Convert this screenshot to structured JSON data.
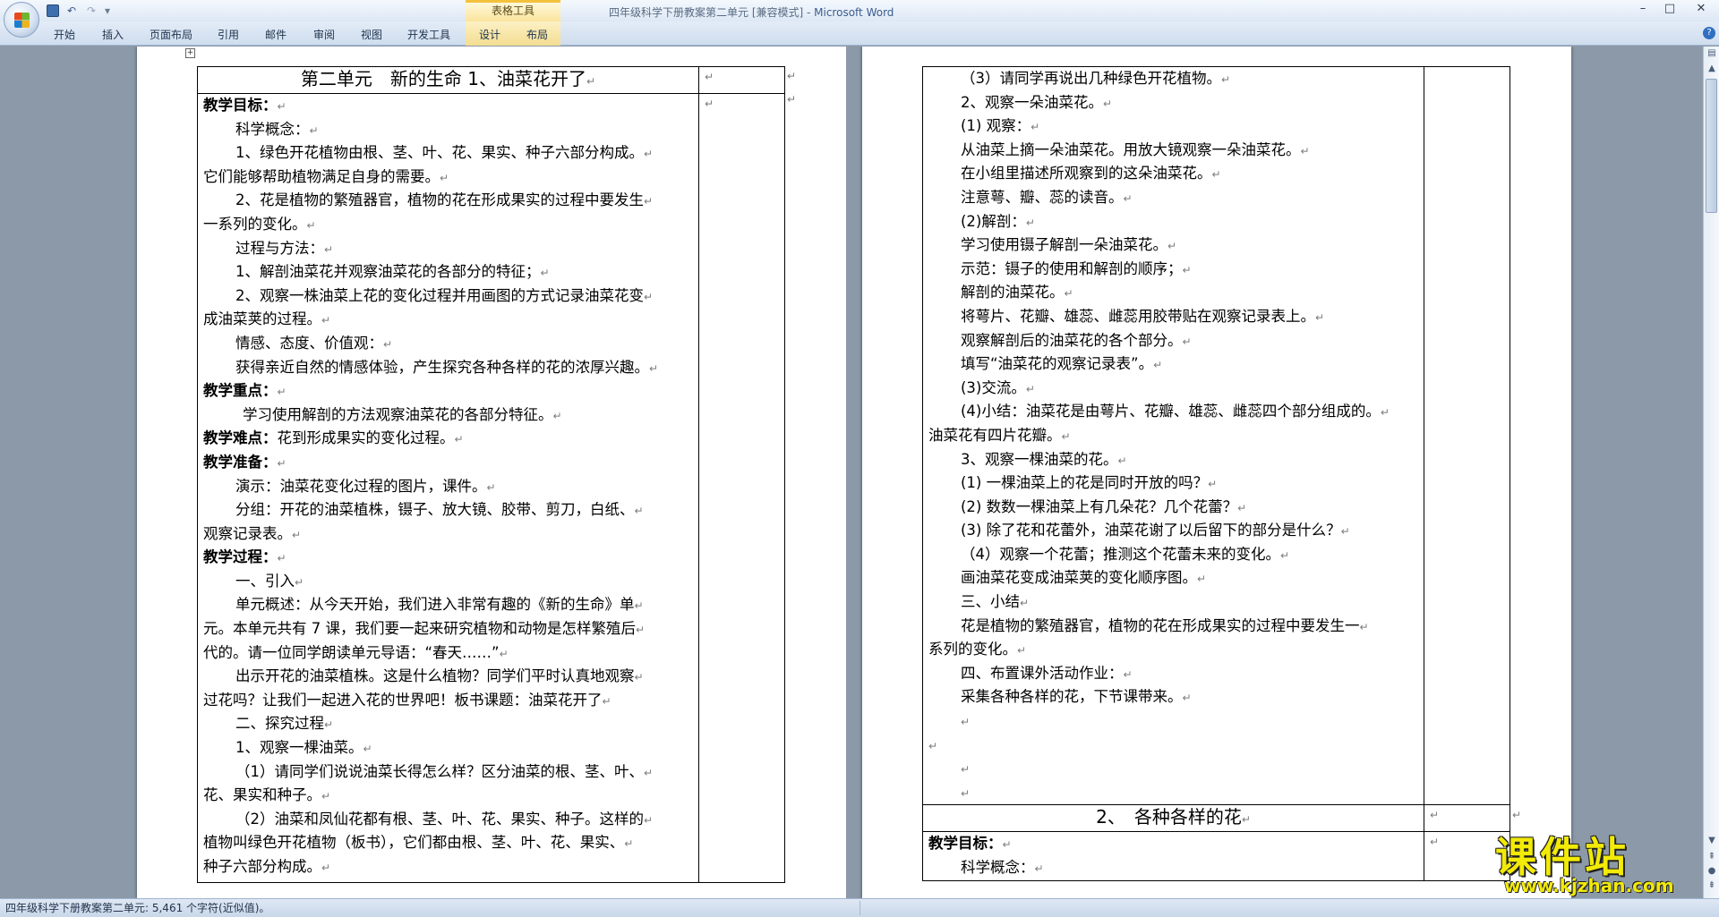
{
  "window": {
    "title": "四年级科学下册教案第二单元 [兼容模式] - ",
    "app_name": "Microsoft Word",
    "context_tab_group": "表格工具",
    "controls": [
      "–",
      "□",
      "✕"
    ]
  },
  "quick_access": {
    "save_icon": "save-icon",
    "undo_icon": "undo-icon",
    "redo_icon": "redo-icon",
    "customize_icon": "customize-qat-icon"
  },
  "ribbon": {
    "tabs": [
      "开始",
      "插入",
      "页面布局",
      "引用",
      "邮件",
      "审阅",
      "视图",
      "开发工具",
      "设计",
      "布局"
    ]
  },
  "status_bar": {
    "text": "四年级科学下册教案第二单元: 5,461 个字符(近似值)。"
  },
  "document": {
    "left_page": {
      "title": "第二单元　新的生命 1、油菜花开了",
      "lines": [
        {
          "text": "教学目标：",
          "style": "b"
        },
        {
          "text": "科学概念：",
          "style": "i2"
        },
        {
          "text": "1、绿色开花植物由根、茎、叶、花、果实、种子六部分构成。",
          "style": "i2"
        },
        {
          "text": "它们能够帮助植物满足自身的需要。",
          "style": ""
        },
        {
          "text": "2、花是植物的繁殖器官，植物的花在形成果实的过程中要发生",
          "style": "i2"
        },
        {
          "text": "一系列的变化。",
          "style": ""
        },
        {
          "text": "过程与方法：",
          "style": "i2"
        },
        {
          "text": "1、解剖油菜花并观察油菜花的各部分的特征；",
          "style": "i2"
        },
        {
          "text": "2、观察一株油菜上花的变化过程并用画图的方式记录油菜花变",
          "style": "i2"
        },
        {
          "text": "成油菜荚的过程。",
          "style": ""
        },
        {
          "text": "情感、态度、价值观：",
          "style": "i2"
        },
        {
          "text": "获得亲近自然的情感体验，产生探究各种各样的花的浓厚兴趣。",
          "style": "i2"
        },
        {
          "text": "教学重点：",
          "style": "b"
        },
        {
          "text": "学习使用解剖的方法观察油菜花的各部分特征。",
          "style": "i3"
        },
        {
          "text": "教学难点：花到形成果实的变化过程。",
          "style": "bl"
        },
        {
          "text": "教学准备：",
          "style": "b"
        },
        {
          "text": "演示：油菜花变化过程的图片，课件。",
          "style": "i2"
        },
        {
          "text": "分组：开花的油菜植株，镊子、放大镜、胶带、剪刀，白纸、",
          "style": "i2"
        },
        {
          "text": "观察记录表。",
          "style": ""
        },
        {
          "text": "教学过程：",
          "style": "b"
        },
        {
          "text": "一、引入",
          "style": "i2"
        },
        {
          "text": "单元概述：从今天开始，我们进入非常有趣的《新的生命》单",
          "style": "i2"
        },
        {
          "text": "元。本单元共有 7 课，我们要一起来研究植物和动物是怎样繁殖后",
          "style": ""
        },
        {
          "text": "代的。请一位同学朗读单元导语：“春天……”",
          "style": ""
        },
        {
          "text": "出示开花的油菜植株。这是什么植物？同学们平时认真地观察",
          "style": "i2"
        },
        {
          "text": "过花吗？让我们一起进入花的世界吧！板书课题：油菜花开了",
          "style": ""
        },
        {
          "text": "二、探究过程",
          "style": "i2"
        },
        {
          "text": "1、观察一棵油菜。",
          "style": "i2"
        },
        {
          "text": "（1）请同学们说说油菜长得怎么样？区分油菜的根、茎、叶、",
          "style": "i2"
        },
        {
          "text": "花、果实和种子。",
          "style": ""
        },
        {
          "text": "（2）油菜和凤仙花都有根、茎、叶、花、果实、种子。这样的",
          "style": "i2"
        },
        {
          "text": "植物叫绿色开花植物（板书），它们都由根、茎、叶、花、果实、",
          "style": ""
        },
        {
          "text": "种子六部分构成。",
          "style": ""
        }
      ]
    },
    "right_page": {
      "lines": [
        {
          "text": "（3）请同学再说出几种绿色开花植物。",
          "style": "i2"
        },
        {
          "text": "2、观察一朵油菜花。",
          "style": "i2"
        },
        {
          "text": "(1) 观察：",
          "style": "i2"
        },
        {
          "text": "从油菜上摘一朵油菜花。用放大镜观察一朵油菜花。",
          "style": "i2"
        },
        {
          "text": "在小组里描述所观察到的这朵油菜花。",
          "style": "i2"
        },
        {
          "text": "注意萼、瓣、蕊的读音。",
          "style": "i2"
        },
        {
          "text": "(2)解剖：",
          "style": "i2"
        },
        {
          "text": "学习使用镊子解剖一朵油菜花。",
          "style": "i2"
        },
        {
          "text": "示范：镊子的使用和解剖的顺序；",
          "style": "i2"
        },
        {
          "text": "解剖的油菜花。",
          "style": "i2"
        },
        {
          "text": "将萼片、花瓣、雄蕊、雌蕊用胶带贴在观察记录表上。",
          "style": "i2"
        },
        {
          "text": "观察解剖后的油菜花的各个部分。",
          "style": "i2"
        },
        {
          "text": "填写“油菜花的观察记录表”。",
          "style": "i2"
        },
        {
          "text": "(3)交流。",
          "style": "i2"
        },
        {
          "text": "(4)小结：油菜花是由萼片、花瓣、雄蕊、雌蕊四个部分组成的。",
          "style": "i2"
        },
        {
          "text": "油菜花有四片花瓣。",
          "style": ""
        },
        {
          "text": "3、观察一棵油菜的花。",
          "style": "i2"
        },
        {
          "text": "(1) 一棵油菜上的花是同时开放的吗？",
          "style": "i2"
        },
        {
          "text": "(2) 数数一棵油菜上有几朵花？几个花蕾？",
          "style": "i2"
        },
        {
          "text": "(3) 除了花和花蕾外，油菜花谢了以后留下的部分是什么？",
          "style": "i2"
        },
        {
          "text": "（4）观察一个花蕾；推测这个花蕾未来的变化。",
          "style": "i2"
        },
        {
          "text": "画油菜花变成油菜荚的变化顺序图。",
          "style": "i2"
        },
        {
          "text": "三、小结",
          "style": "i2"
        },
        {
          "text": "花是植物的繁殖器官，植物的花在形成果实的过程中要发生一",
          "style": "i2"
        },
        {
          "text": "系列的变化。",
          "style": ""
        },
        {
          "text": "四、布置课外活动作业：",
          "style": "i2"
        },
        {
          "text": "采集各种各样的花，下节课带来。",
          "style": "i2"
        },
        {
          "text": "",
          "style": "i2"
        },
        {
          "text": "",
          "style": ""
        },
        {
          "text": "",
          "style": "i2"
        },
        {
          "text": "",
          "style": "i2"
        }
      ],
      "second_title": "2、　各种各样的花",
      "second_lines": [
        {
          "text": "教学目标：",
          "style": "b"
        },
        {
          "text": "科学概念：",
          "style": "i2"
        }
      ]
    }
  },
  "watermark": {
    "title": "课件站",
    "url": "www.kjzhan.com"
  },
  "colors": {
    "workspace_bg": "#8c99a8",
    "ribbon_bg": "#dde8f5",
    "context_tab": "#fbe49d",
    "watermark": "#f2ea07"
  }
}
